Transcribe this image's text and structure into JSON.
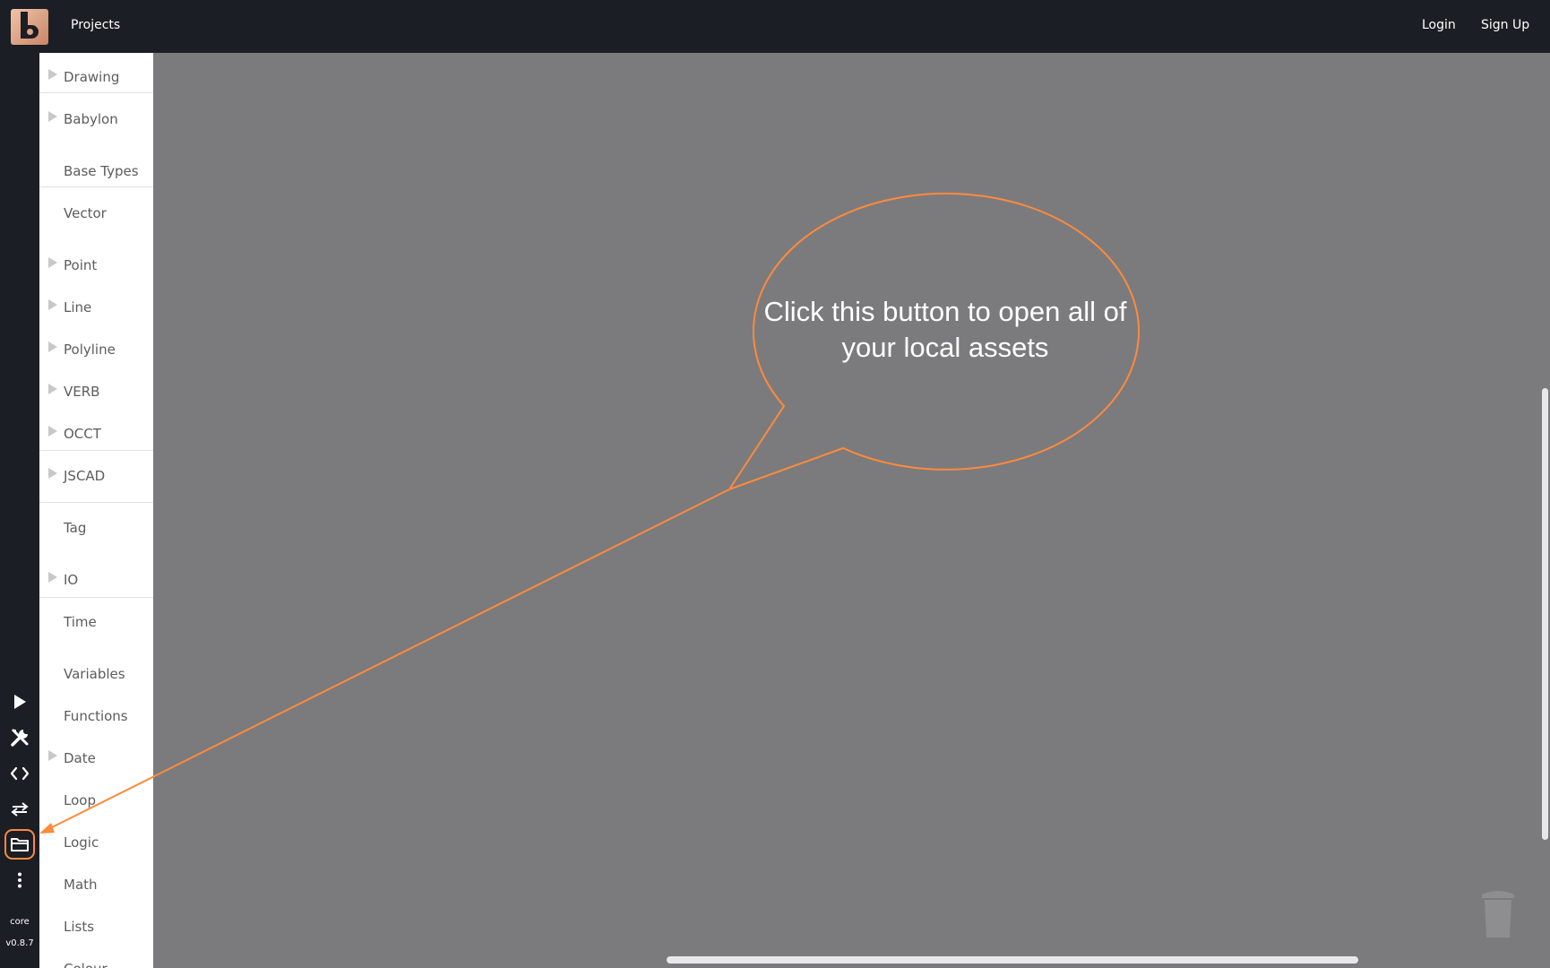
{
  "header": {
    "projects_label": "Projects",
    "login_label": "Login",
    "signup_label": "Sign Up"
  },
  "toolbar": {
    "icons": [
      "play-icon",
      "tools-icon",
      "code-icon",
      "swap-icon",
      "folder-icon",
      "more-vertical-icon"
    ],
    "core_label": "core",
    "version_label": "v0.8.7"
  },
  "categories": [
    {
      "label": "Drawing",
      "expandable": true
    },
    {
      "label": "Babylon",
      "expandable": true
    },
    {
      "label": "Base Types",
      "expandable": false
    },
    {
      "label": "Vector",
      "expandable": false
    },
    {
      "label": "Point",
      "expandable": true
    },
    {
      "label": "Line",
      "expandable": true
    },
    {
      "label": "Polyline",
      "expandable": true
    },
    {
      "label": "VERB",
      "expandable": true
    },
    {
      "label": "OCCT",
      "expandable": true
    },
    {
      "label": "JSCAD",
      "expandable": true
    },
    {
      "label": "Tag",
      "expandable": false
    },
    {
      "label": "IO",
      "expandable": true
    },
    {
      "label": "Time",
      "expandable": false
    },
    {
      "label": "Variables",
      "expandable": false
    },
    {
      "label": "Functions",
      "expandable": false
    },
    {
      "label": "Date",
      "expandable": true
    },
    {
      "label": "Loop",
      "expandable": false
    },
    {
      "label": "Logic",
      "expandable": false
    },
    {
      "label": "Math",
      "expandable": false
    },
    {
      "label": "Lists",
      "expandable": false
    },
    {
      "label": "Colour",
      "expandable": false
    }
  ],
  "callout": {
    "text": "Click this button to open all of your local assets",
    "color": "#ff8a3d"
  },
  "colors": {
    "topbar": "#1b1e24",
    "workspace": "#7b7b7d",
    "panel": "#ffffff",
    "accent": "#ff8a3d"
  }
}
